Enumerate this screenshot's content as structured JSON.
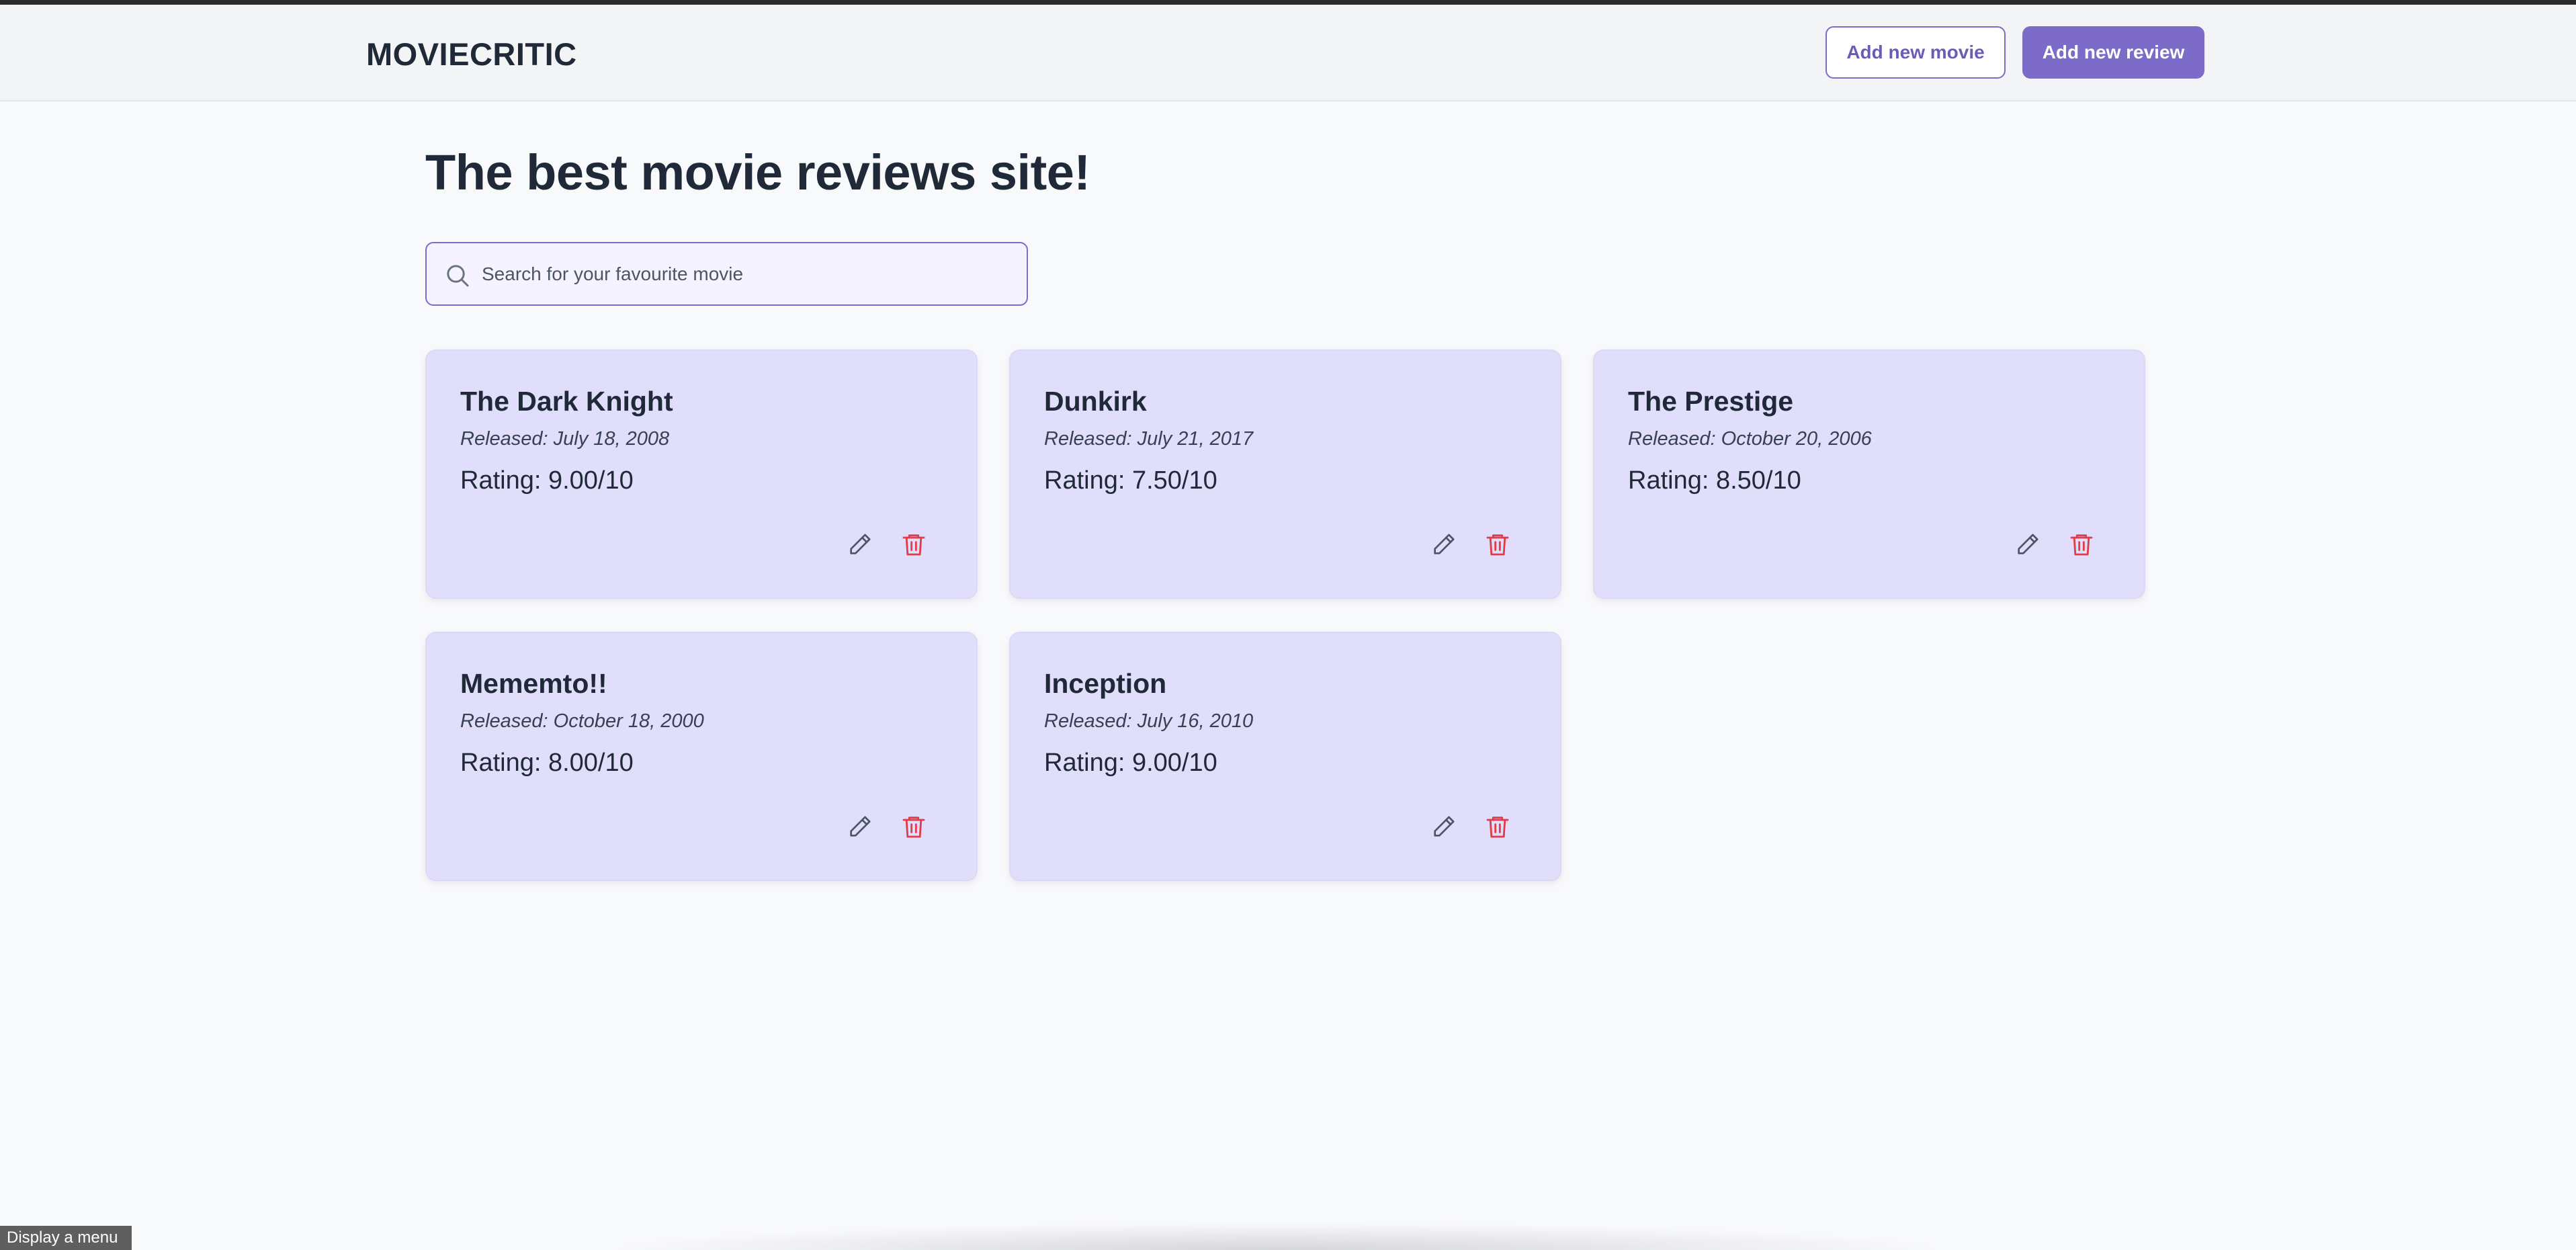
{
  "header": {
    "brand": "MOVIECRITIC",
    "add_movie_label": "Add new movie",
    "add_review_label": "Add new review"
  },
  "main": {
    "title": "The best movie reviews site!",
    "search_placeholder": "Search for your favourite movie",
    "search_value": ""
  },
  "movies": [
    {
      "title": "The Dark Knight",
      "released": "Released: July 18, 2008",
      "rating": "Rating: 9.00/10"
    },
    {
      "title": "Dunkirk",
      "released": "Released: July 21, 2017",
      "rating": "Rating: 7.50/10"
    },
    {
      "title": "The Prestige",
      "released": "Released: October 20, 2006",
      "rating": "Rating: 8.50/10"
    },
    {
      "title": "Mememto!!",
      "released": "Released: October 18, 2000",
      "rating": "Rating: 8.00/10"
    },
    {
      "title": "Inception",
      "released": "Released: July 16, 2010",
      "rating": "Rating: 9.00/10"
    }
  ],
  "icons": {
    "search": "search-icon",
    "edit": "pencil-icon",
    "delete": "trash-icon"
  },
  "colors": {
    "accent": "#7c6bc9",
    "card_bg": "#e0defa",
    "delete": "#e23b4a"
  },
  "tooltip": "Display a menu"
}
